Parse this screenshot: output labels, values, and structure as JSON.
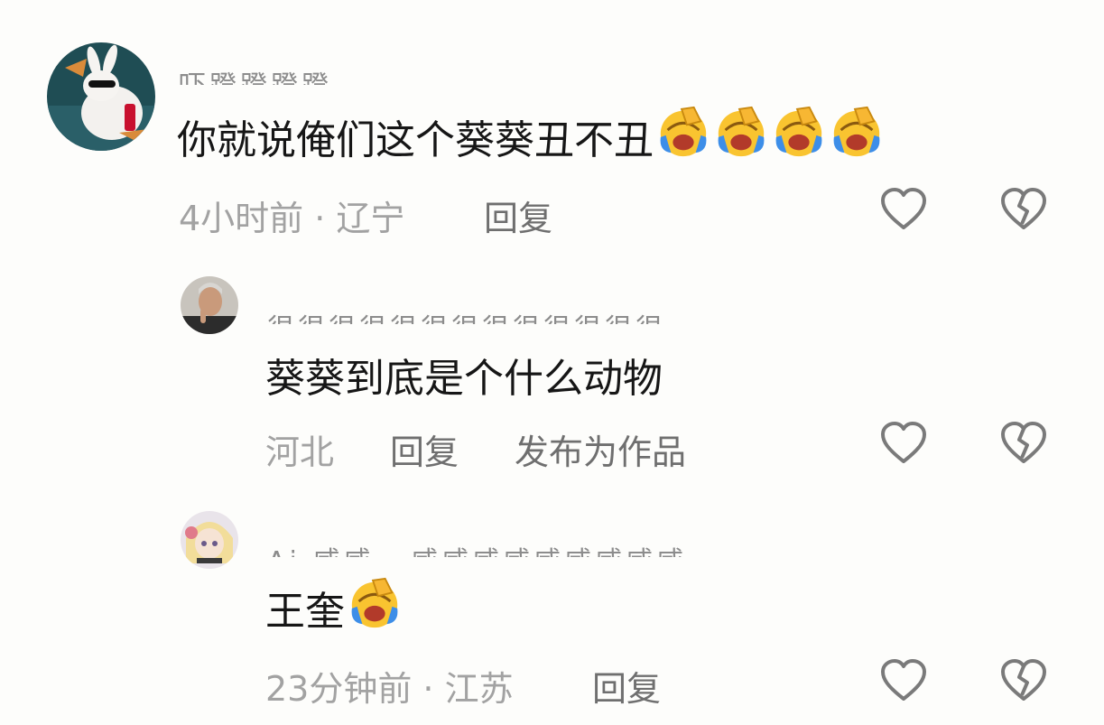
{
  "comments": [
    {
      "username": "吓蹬蹬蹬蹬",
      "text": "你就说俺们这个葵葵丑不丑",
      "emoji_count": 4,
      "emoji": "laughing-crying-emoji",
      "time_location": "4小时前 · 辽宁",
      "reply_label": "回复"
    },
    {
      "username": "很很很很很很很很很很很很很",
      "text": "葵葵到底是个什么动物",
      "location": "河北",
      "reply_label": "回复",
      "publish_label": "发布为作品"
    },
    {
      "username": "Ai 威威 · 威威威威威威威威威",
      "text": "王奎",
      "emoji_count": 1,
      "emoji": "laughing-crying-emoji",
      "time_location": "23分钟前 · 江苏",
      "reply_label": "回复"
    }
  ],
  "icons": {
    "like": "heart-outline-icon",
    "dislike": "broken-heart-icon"
  },
  "colors": {
    "text": "#161616",
    "meta": "#a2a2a2",
    "action": "#6f6f6f",
    "icon": "#7a7a7a",
    "emoji_face": "#f9c430",
    "emoji_tear": "#3d8ee8"
  }
}
